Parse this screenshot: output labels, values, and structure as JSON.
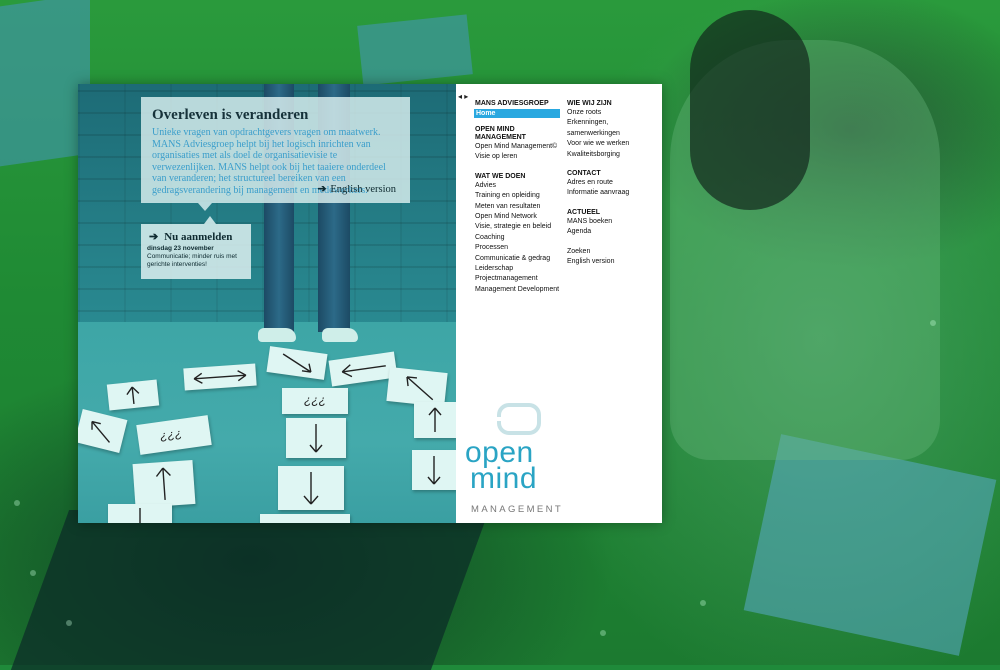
{
  "intro": {
    "title": "Overleven is veranderen",
    "text": "Unieke vragen van opdrachtgevers vragen om maatwerk. MANS Adviesgroep helpt bij het logisch inrichten van organisaties met als doel de organisatievisie te verwezenlijken. MANS helpt ook bij het taaiere onderdeel van veranderen; het structureel bereiken van een gedragsverandering bij management en medewerkers.",
    "english_link": "English version",
    "arrow": "➔"
  },
  "event": {
    "arrow": "➔",
    "title": "Nu aanmelden",
    "date": "dinsdag 23 november",
    "text": "Communicatie; minder ruis met gerichte interventies!"
  },
  "menu": {
    "collapse_arrow": "◂ ▸",
    "col1": {
      "sec1": "MANS ADVIESGROEP",
      "home": "Home",
      "sec2": "OPEN MIND MANAGEMENT",
      "sec2_items": [
        "Open Mind Management©",
        "Visie op leren"
      ],
      "sec3": "WAT WE DOEN",
      "sec3_items": [
        "Advies",
        "Training en opleiding",
        "Meten van resultaten",
        "Open Mind Network",
        "Visie, strategie en beleid",
        "Coaching",
        "Processen",
        "Communicatie & gedrag",
        "Leiderschap",
        "Projectmanagement",
        "Management Development"
      ]
    },
    "col2": {
      "sec1": "WIE WIJ ZIJN",
      "sec1_items": [
        "Onze roots",
        "Erkenningen, samenwerkingen",
        "Voor wie we werken",
        "Kwaliteitsborging"
      ],
      "sec2": "CONTACT",
      "sec2_items": [
        "Adres en route",
        "Informatie aanvraag"
      ],
      "sec3": "ACTUEEL",
      "sec3_items": [
        "MANS boeken",
        "Agenda"
      ],
      "extra_items": [
        "Zoeken",
        "English version"
      ]
    }
  },
  "logo": {
    "open": "open",
    "mind": "mind",
    "management": "MANAGEMENT"
  },
  "photo_cards": [
    "¿¿¿",
    "¿¿¿"
  ],
  "colors": {
    "background_green": "#1f8a3a",
    "accent_blue": "#29a8e0",
    "intro_text": "#3b9ecb",
    "logo": "#2aa4c4"
  }
}
